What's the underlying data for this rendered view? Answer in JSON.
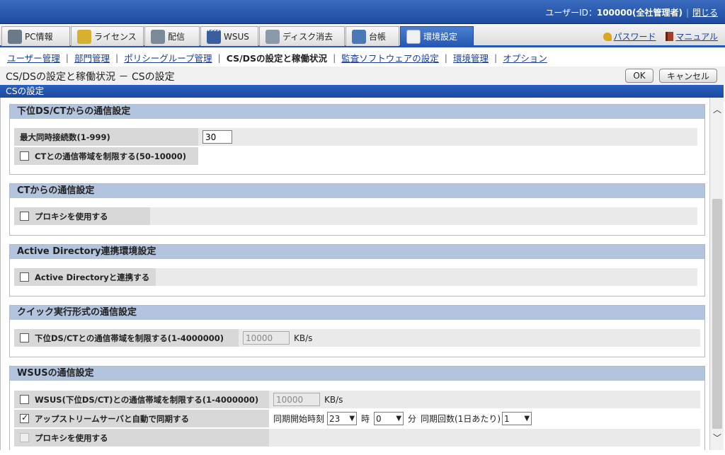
{
  "header": {
    "user_label": "ユーザーID：",
    "user_value": "100000(全社管理者)",
    "close_label": "閉じる"
  },
  "tabs": [
    {
      "label": "PC情報",
      "icon": "pc-icon"
    },
    {
      "label": "ライセンス",
      "icon": "license-icon"
    },
    {
      "label": "配信",
      "icon": "distribution-icon"
    },
    {
      "label": "WSUS",
      "icon": "wsus-icon"
    },
    {
      "label": "ディスク消去",
      "icon": "disk-erase-icon"
    },
    {
      "label": "台帳",
      "icon": "ledger-icon"
    },
    {
      "label": "環境設定",
      "icon": "settings-tools-icon",
      "active": true
    }
  ],
  "toplinks": {
    "password": "パスワード",
    "manual": "マニュアル"
  },
  "subnav": [
    {
      "label": "ユーザー管理"
    },
    {
      "label": "部門管理"
    },
    {
      "label": "ポリシーグループ管理"
    },
    {
      "label": "CS/DSの設定と稼働状況",
      "current": true
    },
    {
      "label": "監査ソフトウェアの設定"
    },
    {
      "label": "環境管理"
    },
    {
      "label": "オプション"
    }
  ],
  "page": {
    "title": "CS/DSの設定と稼働状況 － CSの設定",
    "ok_label": "OK",
    "cancel_label": "キャンセル",
    "section_title": "CSの設定"
  },
  "groups": {
    "lower": {
      "title": "下位DS/CTからの通信設定",
      "max_conn_label": "最大同時接続数(1-999)",
      "max_conn_value": "30",
      "ct_bw_label": "CTとの通信帯域を制限する(50-10000)"
    },
    "ct": {
      "title": "CTからの通信設定",
      "proxy_label": "プロキシを使用する"
    },
    "ad": {
      "title": "Active Directory連携環境設定",
      "ad_label": "Active Directoryと連携する"
    },
    "quick": {
      "title": "クイック実行形式の通信設定",
      "bw_label": "下位DS/CTとの通信帯域を制限する(1-4000000)",
      "bw_value": "10000",
      "bw_unit": "KB/s"
    },
    "wsus": {
      "title": "WSUSの通信設定",
      "bw_label": "WSUS(下位DS/CT)との通信帯域を制限する(1-4000000)",
      "bw_value": "10000",
      "bw_unit": "KB/s",
      "sync_label": "アップストリームサーバと自動で同期する",
      "sync_start_label": "同期開始時刻",
      "sync_hour": "23",
      "hour_unit": "時",
      "sync_min": "0",
      "min_unit": "分",
      "sync_count_label": "同期回数(1日あたり)",
      "sync_count": "1",
      "proxy_label": "プロキシを使用する"
    }
  }
}
